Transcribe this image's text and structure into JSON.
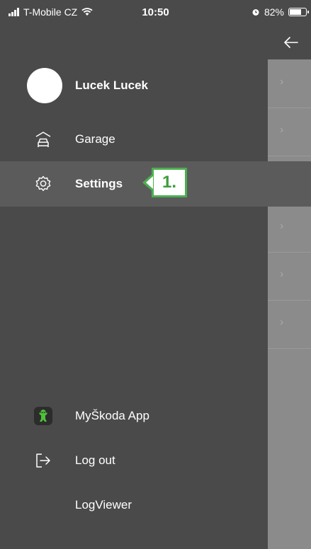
{
  "status_bar": {
    "carrier": "T-Mobile CZ",
    "time": "10:50",
    "battery": "82%",
    "battery_level": 0.82
  },
  "header": {
    "back_icon": "arrow-left-icon"
  },
  "profile": {
    "name": "Lucek Lucek"
  },
  "menu": {
    "items": [
      {
        "label": "Garage",
        "icon": "car-garage-icon"
      },
      {
        "label": "Settings",
        "icon": "gear-icon",
        "active": true
      }
    ]
  },
  "annotation": {
    "label": "1."
  },
  "bottom_menu": {
    "items": [
      {
        "label": "MyŠkoda App",
        "icon": "myskoda-app-icon"
      },
      {
        "label": "Log out",
        "icon": "logout-icon"
      },
      {
        "label": "LogViewer",
        "icon": ""
      }
    ]
  },
  "colors": {
    "drawer_bg": "#4a4a4a",
    "active_bg": "#5b5b5b",
    "overlay_bg": "#8b8b8b",
    "annotation_green": "#4caf50"
  }
}
